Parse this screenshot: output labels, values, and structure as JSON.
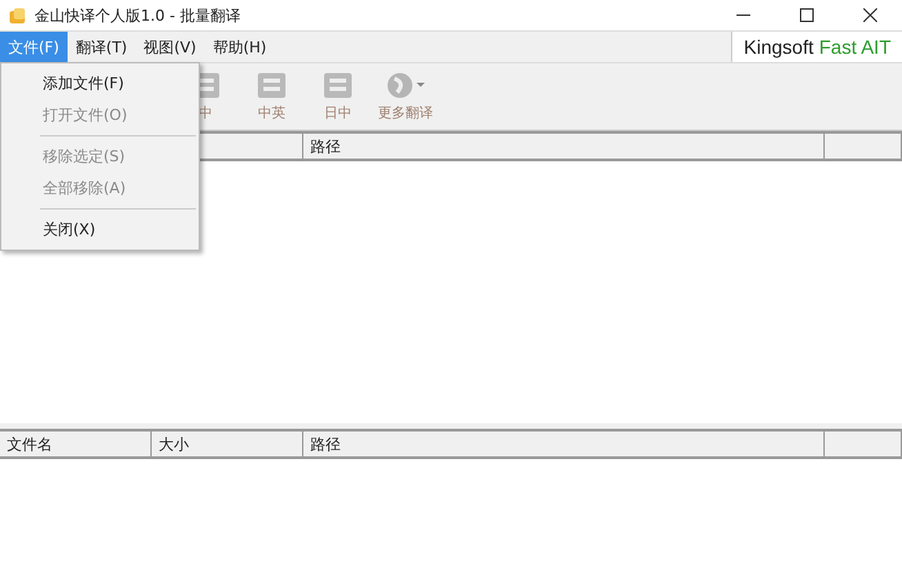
{
  "window": {
    "title": "金山快译个人版1.0 - 批量翻译"
  },
  "menubar": [
    {
      "label": "文件(F)",
      "selected": true
    },
    {
      "label": "翻译(T)",
      "selected": false
    },
    {
      "label": "视图(V)",
      "selected": false
    },
    {
      "label": "帮助(H)",
      "selected": false
    }
  ],
  "logo": {
    "brand": "Kingsoft",
    "product": "Fast AIT"
  },
  "toolbar": [
    {
      "label": "中",
      "kind": "glyph"
    },
    {
      "label": "中英",
      "kind": "glyph"
    },
    {
      "label": "日中",
      "kind": "glyph"
    },
    {
      "label": "更多翻译",
      "kind": "more"
    }
  ],
  "file_list": {
    "columns": [
      {
        "label": "路径"
      }
    ]
  },
  "result_list": {
    "columns": [
      {
        "label": "文件名"
      },
      {
        "label": "大小"
      },
      {
        "label": "路径"
      }
    ]
  },
  "menu": {
    "items": [
      {
        "kind": "item",
        "label": "添加文件(F)",
        "disabled": false
      },
      {
        "kind": "item",
        "label": "打开文件(O)",
        "disabled": true
      },
      {
        "kind": "separator"
      },
      {
        "kind": "item",
        "label": "移除选定(S)",
        "disabled": true
      },
      {
        "kind": "item",
        "label": "全部移除(A)",
        "disabled": true
      },
      {
        "kind": "separator"
      },
      {
        "kind": "item",
        "label": "关闭(X)",
        "disabled": false
      }
    ]
  }
}
